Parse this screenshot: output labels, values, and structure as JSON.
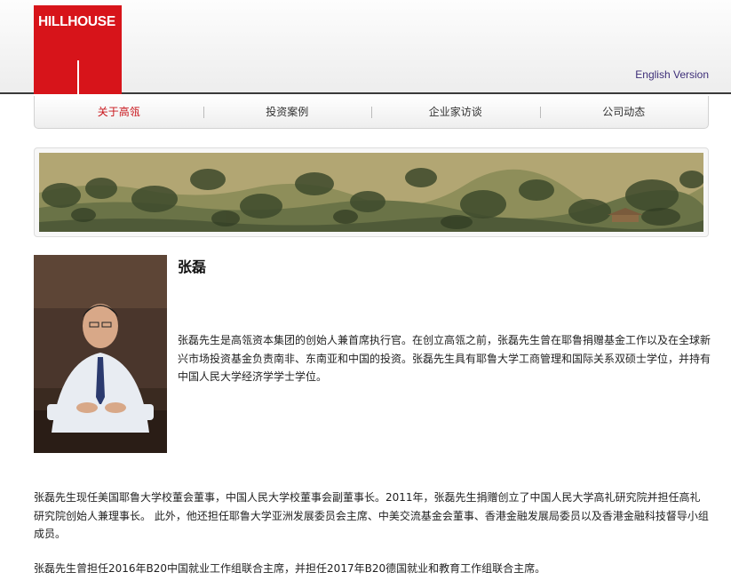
{
  "header": {
    "logo_text": "HILLHOUSE",
    "lang_link": "English Version",
    "colors": {
      "brand_red": "#d7141a",
      "link": "#3d2e78"
    }
  },
  "nav": {
    "items": [
      {
        "label": "关于高瓴",
        "active": true
      },
      {
        "label": "投资案例",
        "active": false
      },
      {
        "label": "企业家访谈",
        "active": false
      },
      {
        "label": "公司动态",
        "active": false
      }
    ]
  },
  "profile": {
    "name": "张磊",
    "intro": "张磊先生是高瓴资本集团的创始人兼首席执行官。在创立高瓴之前，张磊先生曾在耶鲁捐赠基金工作以及在全球新兴市场投资基金负责南非、东南亚和中国的投资。张磊先生具有耶鲁大学工商管理和国际关系双硕士学位，并持有中国人民大学经济学学士学位。",
    "para1": "张磊先生现任美国耶鲁大学校董会董事，中国人民大学校董事会副董事长。2011年，张磊先生捐赠创立了中国人民大学高礼研究院并担任高礼研究院创始人兼理事长。 此外，他还担任耶鲁大学亚洲发展委员会主席、中美交流基金会董事、香港金融发展局委员以及香港金融科技督导小组成员。",
    "para2": "张磊先生曾担任2016年B20中国就业工作组联合主席，并担任2017年B20德国就业和教育工作组联合主席。"
  }
}
